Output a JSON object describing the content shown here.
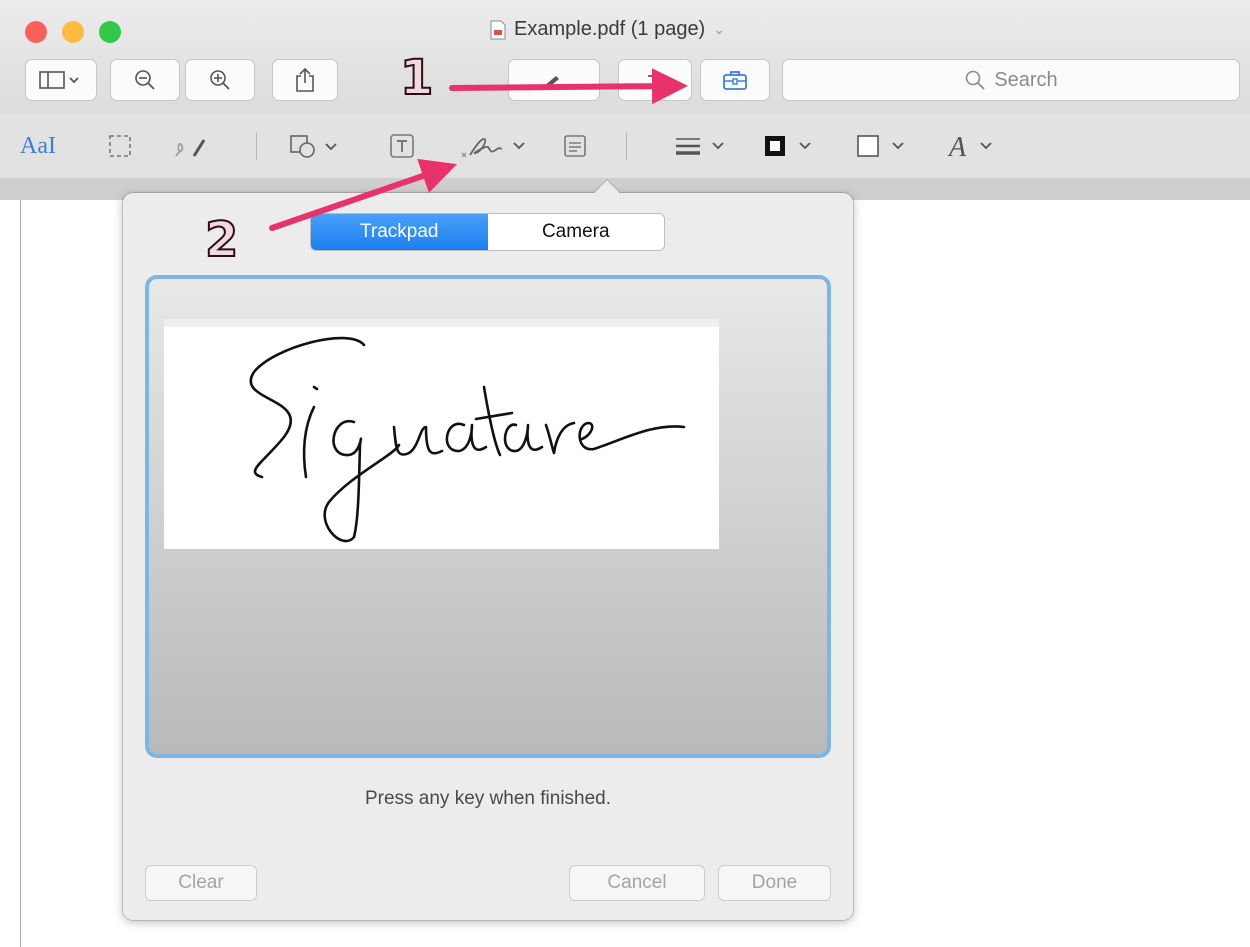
{
  "window": {
    "title": "Example.pdf (1 page)",
    "traffic_lights": {
      "close": "#fc605c",
      "minimize": "#fdbc40",
      "zoom": "#34c84a"
    }
  },
  "toolbar": {
    "search_placeholder": "Search"
  },
  "markup_toolbar": {
    "text_style_label": "AaI",
    "accent_color": "#3b7fd9"
  },
  "signature_popover": {
    "tabs": [
      {
        "label": "Trackpad",
        "selected": true
      },
      {
        "label": "Camera",
        "selected": false
      }
    ],
    "instruction": "Press any key when finished.",
    "buttons": {
      "clear": "Clear",
      "cancel": "Cancel",
      "done": "Done"
    },
    "pad_border_color": "#7fb5e1"
  },
  "annotations": {
    "callout_1": "1",
    "callout_2": "2",
    "arrow_color": "#e8336a"
  }
}
